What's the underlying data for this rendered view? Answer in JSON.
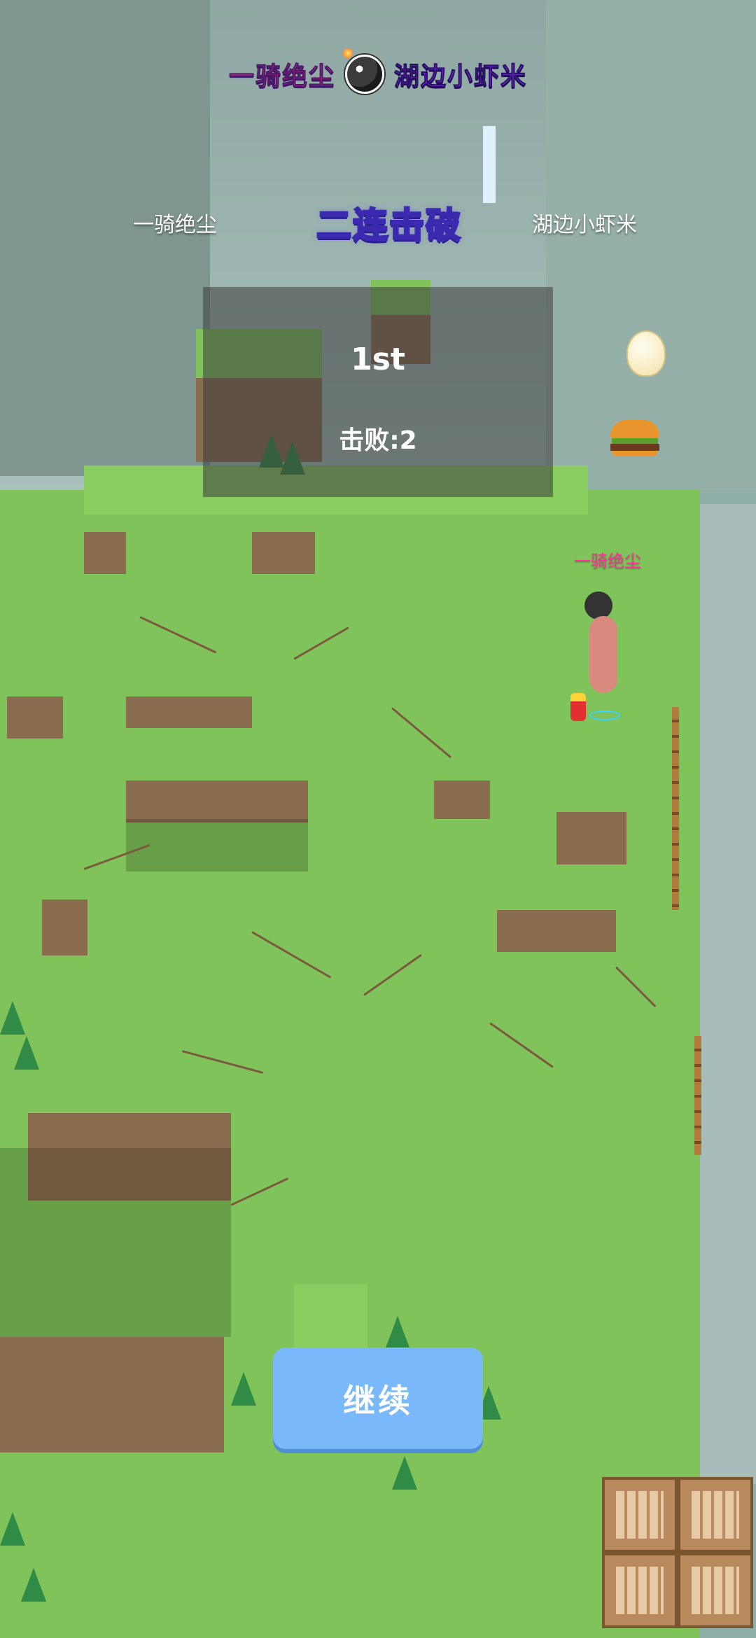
{
  "killfeed": {
    "attacker": "一骑绝尘",
    "icon": "bomb-icon",
    "victim": "湖边小虾米"
  },
  "versus": {
    "left_player": "一骑绝尘",
    "combo_label": "二连击破",
    "right_player": "湖边小虾米"
  },
  "result": {
    "rank": "1st",
    "defeat_text": "击败:2"
  },
  "player": {
    "name_tag": "一骑绝尘"
  },
  "actions": {
    "continue_label": "继续"
  },
  "colors": {
    "continue_button": "#79b9f9",
    "combo_text": "#ffd23a",
    "attacker_text": "#ff2f9a",
    "victim_text": "#8b3cff",
    "grass": "#7fc35a"
  }
}
